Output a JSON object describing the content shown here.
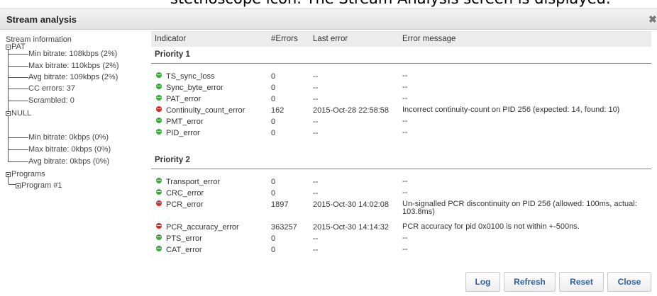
{
  "caption_text": "stethoscope icon. The Stream Analysis screen is displayed.",
  "dialog": {
    "title": "Stream analysis",
    "close_glyph": "✖"
  },
  "tree": {
    "root": "Stream information",
    "pat": {
      "label": "PAT",
      "leaves": [
        "Min bitrate: 108kbps (2%)",
        "Max bitrate: 110kbps (2%)",
        "Avg bitrate: 109kbps (2%)",
        "CC errors: 37",
        "Scrambled: 0"
      ]
    },
    "null": {
      "label": "NULL",
      "leaves": [
        "Min bitrate: 0kbps (0%)",
        "Max bitrate: 0kbps (0%)",
        "Avg bitrate: 0kbps (0%)"
      ]
    },
    "programs": {
      "label": "Programs",
      "child": "Program #1"
    }
  },
  "table": {
    "headers": {
      "indicator": "Indicator",
      "errors": "#Errors",
      "last_error": "Last error",
      "message": "Error message"
    },
    "priority1": {
      "label": "Priority 1",
      "rows": [
        {
          "status": "ok",
          "name": "TS_sync_loss",
          "errors": "0",
          "last": "--",
          "message": "--"
        },
        {
          "status": "ok",
          "name": "Sync_byte_error",
          "errors": "0",
          "last": "--",
          "message": "--"
        },
        {
          "status": "ok",
          "name": "PAT_error",
          "errors": "0",
          "last": "--",
          "message": "--"
        },
        {
          "status": "error",
          "name": "Continuity_count_error",
          "errors": "162",
          "last": "2015-Oct-28 22:58:58",
          "message": "Incorrect continuity-count on PID 256 (expected: 14, found: 10)"
        },
        {
          "status": "ok",
          "name": "PMT_error",
          "errors": "0",
          "last": "--",
          "message": "--"
        },
        {
          "status": "ok",
          "name": "PID_error",
          "errors": "0",
          "last": "--",
          "message": "--"
        }
      ]
    },
    "priority2": {
      "label": "Priority 2",
      "rows": [
        {
          "status": "ok",
          "name": "Transport_error",
          "errors": "0",
          "last": "--",
          "message": "--"
        },
        {
          "status": "ok",
          "name": "CRC_error",
          "errors": "0",
          "last": "--",
          "message": "--"
        },
        {
          "status": "error",
          "name": "PCR_error",
          "errors": "1897",
          "last": "2015-Oct-30 14:02:08",
          "message": "Un-signalled PCR discontinuity on PID 256 (allowed: 100ms, actual: 103.8ms)"
        },
        {
          "status": "error",
          "name": "PCR_accuracy_error",
          "errors": "363257",
          "last": "2015-Oct-30 14:14:32",
          "message": "PCR accuracy for pid 0x0100 is not within +-500ns."
        },
        {
          "status": "ok",
          "name": "PTS_error",
          "errors": "0",
          "last": "--",
          "message": "--"
        },
        {
          "status": "ok",
          "name": "CAT_error",
          "errors": "0",
          "last": "--",
          "message": "--"
        }
      ]
    }
  },
  "buttons": {
    "log": "Log",
    "refresh": "Refresh",
    "reset": "Reset",
    "close": "Close"
  },
  "colors": {
    "ok": "#3aaa3a",
    "error": "#d9252c",
    "button_text": "#2f5fa0"
  }
}
